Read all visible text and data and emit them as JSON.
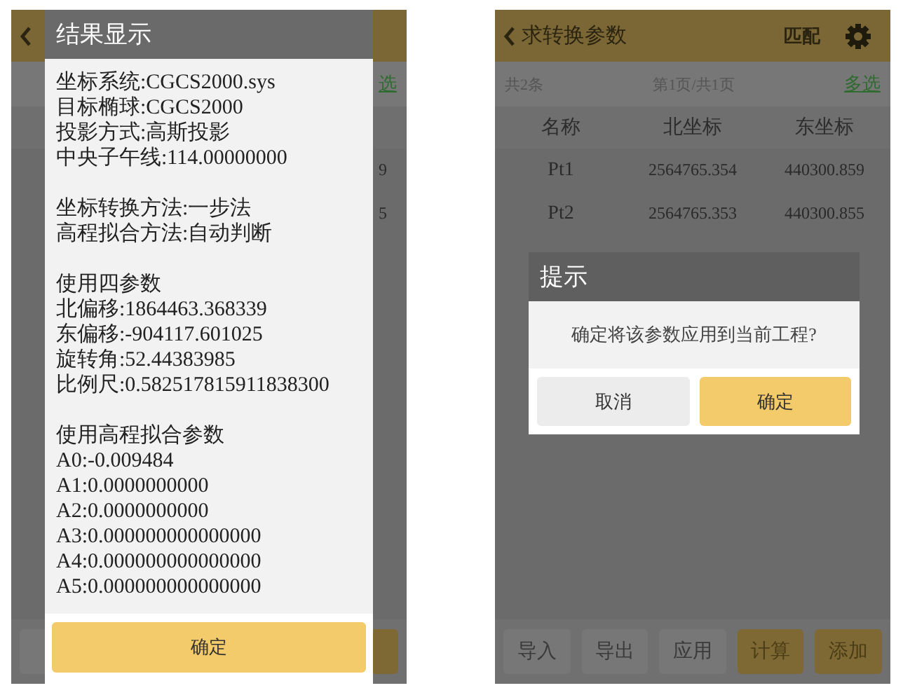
{
  "left_screen": {
    "multi_select": "选",
    "row_ends": [
      "9",
      "5"
    ],
    "result_dialog": {
      "title": "结果显示",
      "sections": [
        [
          "坐标系统:CGCS2000.sys",
          "目标椭球:CGCS2000",
          "投影方式:高斯投影",
          "中央子午线:114.00000000"
        ],
        [
          "坐标转换方法:一步法",
          "高程拟合方法:自动判断"
        ],
        [
          "使用四参数",
          "北偏移:1864463.368339",
          "东偏移:-904117.601025",
          "旋转角:52.44383985",
          "比例尺:0.582517815911838300"
        ],
        [
          "使用高程拟合参数",
          "A0:-0.009484",
          "A1:0.0000000000",
          "A2:0.0000000000",
          "A3:0.000000000000000",
          "A4:0.000000000000000",
          "A5:0.000000000000000"
        ]
      ],
      "button": "确定"
    }
  },
  "right_screen": {
    "title": "求转换参数",
    "match": "匹配",
    "count": "共2条",
    "page": "第1页/共1页",
    "multi_select": "多选",
    "columns": [
      "名称",
      "北坐标",
      "东坐标"
    ],
    "rows": [
      [
        "Pt1",
        "2564765.354",
        "440300.859"
      ],
      [
        "Pt2",
        "2564765.353",
        "440300.855"
      ]
    ],
    "prompt_dialog": {
      "title": "提示",
      "message": "确定将该参数应用到当前工程?",
      "buttons": [
        {
          "label": "取消",
          "kind": "secondary"
        },
        {
          "label": "确定",
          "kind": "primary"
        }
      ]
    },
    "toolbar": [
      {
        "label": "导入",
        "kind": "plain"
      },
      {
        "label": "导出",
        "kind": "plain"
      },
      {
        "label": "应用",
        "kind": "plain"
      },
      {
        "label": "计算",
        "kind": "accent"
      },
      {
        "label": "添加",
        "kind": "accent"
      }
    ]
  }
}
